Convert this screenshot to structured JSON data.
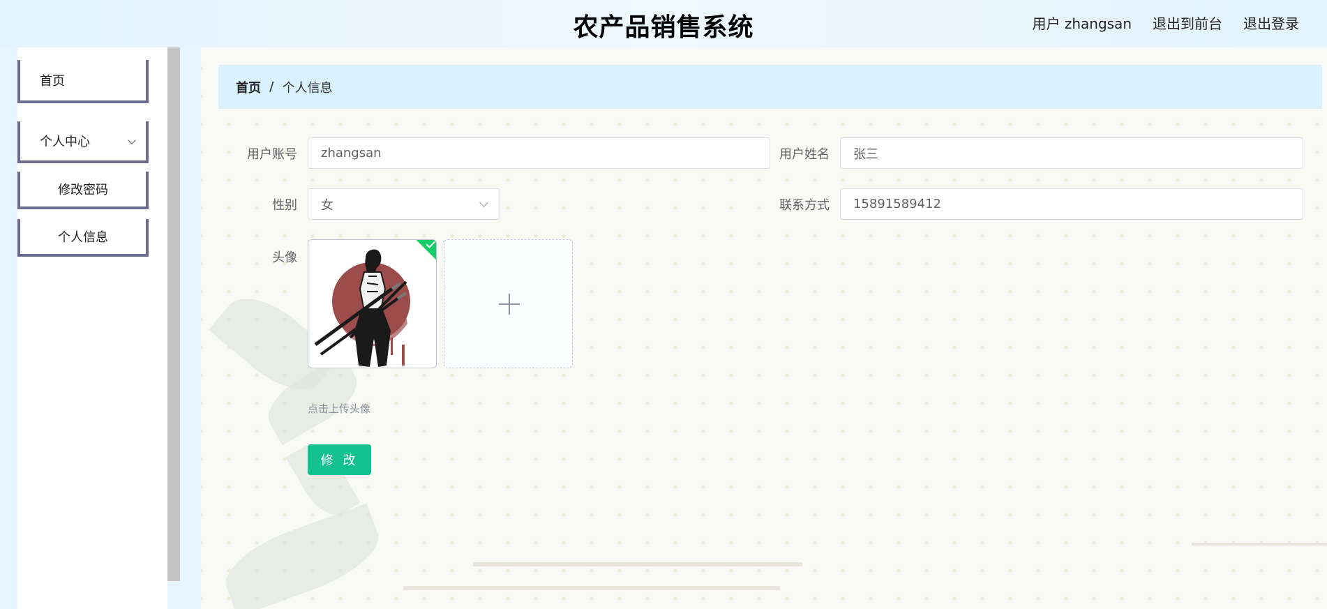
{
  "header": {
    "title": "农产品销售系统",
    "user_label": "用户 zhangsan",
    "back_to_front": "退出到前台",
    "logout": "退出登录"
  },
  "sidebar": {
    "items": [
      {
        "label": "首页"
      },
      {
        "label": "个人中心",
        "expanded": true
      },
      {
        "label": "修改密码"
      },
      {
        "label": "个人信息"
      }
    ]
  },
  "breadcrumb": {
    "home": "首页",
    "separator": "/",
    "current": "个人信息"
  },
  "form": {
    "account": {
      "label": "用户账号",
      "value": "zhangsan"
    },
    "name": {
      "label": "用户姓名",
      "value": "张三"
    },
    "gender": {
      "label": "性别",
      "value": "女"
    },
    "phone": {
      "label": "联系方式",
      "value": "15891589412"
    },
    "avatar": {
      "label": "头像",
      "tip": "点击上传头像",
      "uploaded": true,
      "upload_icon": "plus-icon"
    },
    "submit_label": "修 改"
  },
  "colors": {
    "header_bg": "#e3f4fd",
    "breadcrumb_bg": "#d9f2fd",
    "menu_border": "#6d6b92",
    "primary_button": "#13c090",
    "success_mark": "#13ce66"
  }
}
